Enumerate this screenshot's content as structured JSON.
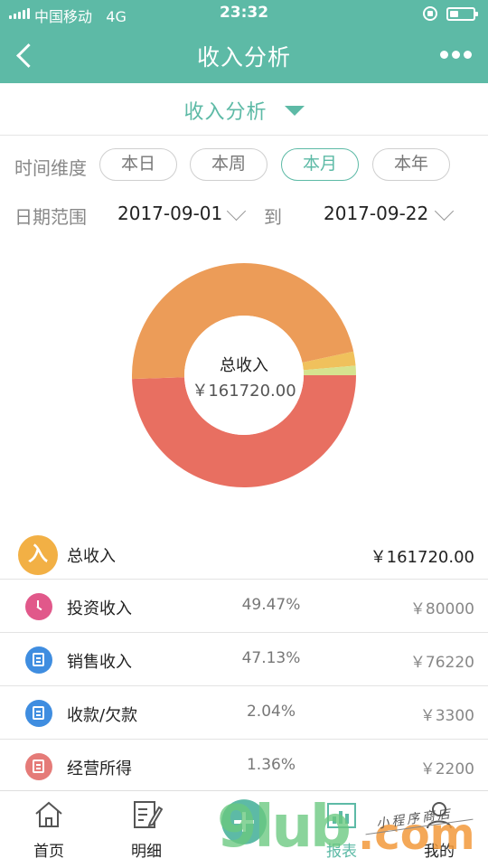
{
  "status_bar": {
    "carrier": "中国移动",
    "network": "4G",
    "time": "23:32"
  },
  "nav": {
    "title": "收入分析"
  },
  "dropdown": {
    "label": "收入分析"
  },
  "time_dimension": {
    "label": "时间维度",
    "options": [
      "本日",
      "本周",
      "本月",
      "本年"
    ],
    "selected": "本月"
  },
  "date_range": {
    "label": "日期范围",
    "start": "2017-09-01",
    "to_label": "到",
    "end": "2017-09-22"
  },
  "chart_data": {
    "type": "pie",
    "center_title": "总收入",
    "center_value": "￥161720.00",
    "slices": [
      {
        "value": 80000,
        "percent": 49.47,
        "color": "#e86f61"
      },
      {
        "value": 76220,
        "percent": 47.13,
        "color": "#ec9c58"
      },
      {
        "value": 3300,
        "percent": 2.04,
        "color": "#f0c15c"
      },
      {
        "value": 2200,
        "percent": 1.36,
        "color": "#d6e38f"
      }
    ]
  },
  "summary": {
    "badge": "入",
    "name": "总收入",
    "amount": "￥161720.00",
    "badge_color": "#f2b045"
  },
  "items": [
    {
      "name": "投资收入",
      "percent": "49.47%",
      "amount": "￥80000",
      "icon": "clock-icon",
      "color": "#e1588a"
    },
    {
      "name": "销售收入",
      "percent": "47.13%",
      "amount": "￥76220",
      "icon": "document-icon",
      "color": "#3f8de0"
    },
    {
      "name": "收款/欠款",
      "percent": "2.04%",
      "amount": "￥3300",
      "icon": "document-icon",
      "color": "#3f8de0"
    },
    {
      "name": "经营所得",
      "percent": "1.36%",
      "amount": "￥2200",
      "icon": "document-icon",
      "color": "#e57b78"
    }
  ],
  "tabs": [
    {
      "label": "首页",
      "icon": "home-icon"
    },
    {
      "label": "明细",
      "icon": "edit-document-icon"
    },
    {
      "label": "",
      "icon": "add-icon"
    },
    {
      "label": "报表",
      "icon": "report-chart-icon"
    },
    {
      "label": "我的",
      "icon": "user-icon"
    }
  ],
  "watermark": {
    "main": "9lub",
    "suffix": ".com",
    "tagline": "小程序商店"
  }
}
